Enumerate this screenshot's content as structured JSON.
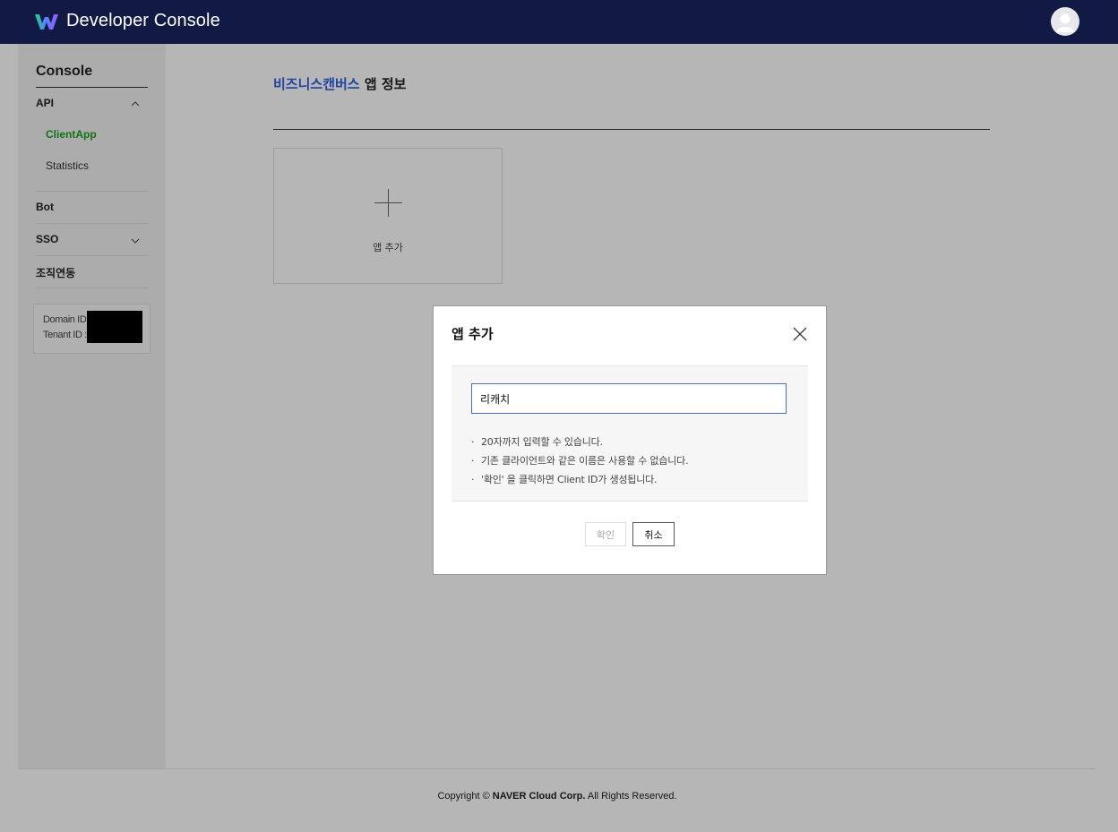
{
  "header": {
    "app_title": "Developer Console",
    "logo_icon": "works-logo-icon",
    "avatar_icon": "user-avatar-icon"
  },
  "sidebar": {
    "title": "Console",
    "sections": [
      {
        "label": "API",
        "expanded": true,
        "chevron": "chevron-up-icon",
        "items": [
          {
            "label": "ClientApp",
            "active": true
          },
          {
            "label": "Statistics",
            "active": false
          }
        ]
      },
      {
        "label": "Bot"
      },
      {
        "label": "SSO",
        "expanded": false,
        "chevron": "chevron-down-icon"
      },
      {
        "label": "조직연동"
      }
    ],
    "domain_label": "Domain ID :",
    "tenant_label": "Tenant ID :"
  },
  "main": {
    "title_brand": "비즈니스캔버스",
    "title_rest": " 앱 정보",
    "add_card_label": "앱 추가"
  },
  "modal": {
    "title": "앱 추가",
    "input_value": "리캐치",
    "hints": [
      "20자까지 입력할 수 있습니다.",
      "기존 클라이언트와 같은 이름은 사용할 수 없습니다.",
      "'확인' 을 클릭하면 Client ID가 생성됩니다."
    ],
    "ok_label": "확인",
    "cancel_label": "취소"
  },
  "footer": {
    "prefix": "Copyright © ",
    "company": "NAVER Cloud Corp.",
    "suffix": " All Rights Reserved."
  },
  "colors": {
    "topbar": "#111a44",
    "brand_blue": "#2d5fe0",
    "active_green": "#19a11b",
    "input_border": "#4a6eb8"
  }
}
